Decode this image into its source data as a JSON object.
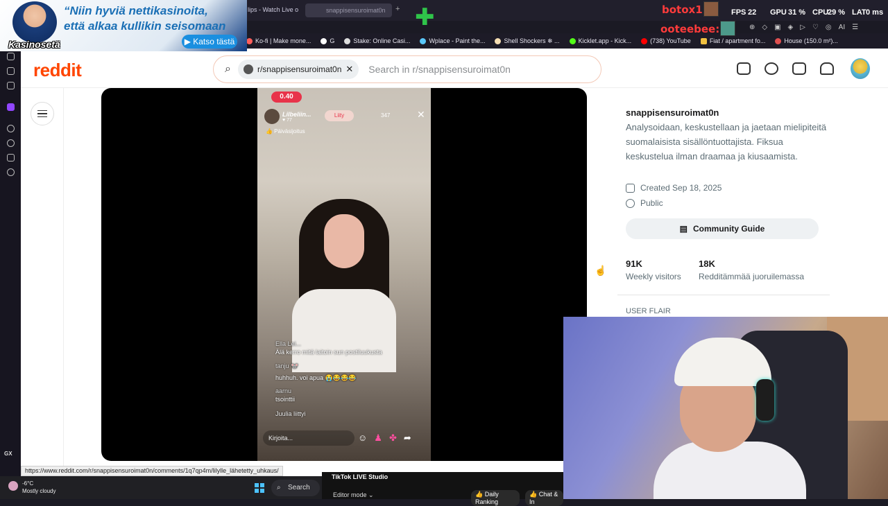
{
  "browser": {
    "tabs": [
      {
        "label": "lips - Watch Live o"
      },
      {
        "label": "snappisensuroimat0n"
      }
    ],
    "bookmarks": [
      "Ko-fi | Make mone...",
      "G",
      "Stake: Online Casi...",
      "Wplace - Paint the...",
      "Shell Shockers ❄ ...",
      "Kicklet.app - Kick...",
      "(738) YouTube",
      "Fiat / apartment fo...",
      "House (150.0 m²)..."
    ],
    "status_url": "https://www.reddit.com/r/snappisensuroimat0n/comments/1q7qp4m/lilylle_lähetetty_uhkaus/",
    "gx_label": "GX"
  },
  "overlay": {
    "casino_line1": "“Niin hyviä nettikasinoita,",
    "casino_line2": "että alkaa kullikin seisomaan",
    "casino_brand": "Kasinosetä",
    "casino_button": "▶ Katso tästä",
    "fps_label": "FPS",
    "fps_value": "22",
    "gpu_label": "GPU",
    "gpu_value": "31 %",
    "cpu_label": "CPU",
    "cpu_value": "29 %",
    "lat_label": "LAT",
    "lat_value": "0 ms",
    "chatter1": "botox1:",
    "chatter2": "ooteebee:"
  },
  "reddit": {
    "logo": "reddit",
    "search_chip": "r/snappisensuroimat0n",
    "search_placeholder": "Search in r/snappisensuroimat0n",
    "subreddit": {
      "name": "snappisensuroimat0n",
      "description": "Analysoidaan, keskustellaan ja jaetaan mielipiteitä suomalaisista sisällöntuottajista. Fiksua keskustelua ilman draamaa ja kiusaamista.",
      "created": "Created Sep 18, 2025",
      "visibility": "Public",
      "guide_button": "Community Guide",
      "stats": [
        {
          "value": "91K",
          "label": "Weekly visitors"
        },
        {
          "value": "18K",
          "label": "Redditämmää juoruilemassa"
        }
      ],
      "flair_heading": "USER FLAIR"
    }
  },
  "tiktok_live": {
    "timer": "0.40",
    "username": "Lilbeliin...",
    "likes": "♥ 77",
    "join_button": "Liity",
    "viewers": "347",
    "pinned": "👍 Päiväsijoitus",
    "comments": [
      {
        "user": "Ella Lei...",
        "text": "Älä kerro mitä laitoin sun postiluukusta"
      },
      {
        "user": "tanju 🐭",
        "text": "huhhuh. voi apua 😭😂😂😂"
      },
      {
        "user": "aarnu",
        "text": "tsointtii"
      },
      {
        "user": "",
        "text": "Juulia liittyi"
      }
    ],
    "input_placeholder": "Kirjoita..."
  },
  "taskbar": {
    "temperature": "-6°C",
    "weather": "Mostly cloudy",
    "search": "Search",
    "tiktok_studio_title": "TikTok LIVE Studio",
    "editor_mode": "Editor mode ⌄",
    "daily_ranking": "👍 Daily Ranking",
    "chat": "👍 Chat & In"
  }
}
